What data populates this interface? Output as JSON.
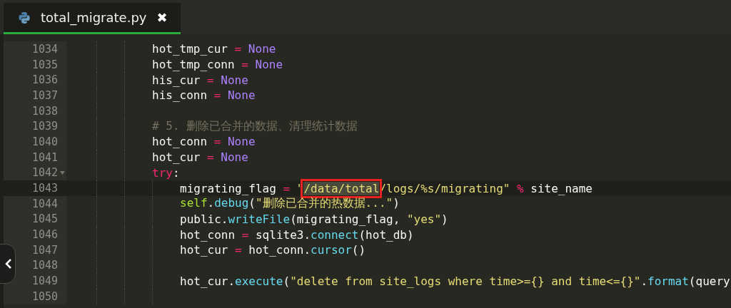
{
  "tabs": [
    {
      "label": "total_migrate.py",
      "close": "✖",
      "selected": true
    }
  ],
  "editor": {
    "lines": [
      {
        "number": "1034",
        "current": false,
        "foldable": false,
        "tokens": [
          {
            "kind": "name",
            "text": "hot_tmp_cur "
          },
          {
            "kind": "op",
            "text": "="
          },
          {
            "kind": "const",
            "text": " None"
          }
        ]
      },
      {
        "number": "1035",
        "current": false,
        "foldable": false,
        "tokens": [
          {
            "kind": "name",
            "text": "hot_tmp_conn "
          },
          {
            "kind": "op",
            "text": "="
          },
          {
            "kind": "const",
            "text": " None"
          }
        ]
      },
      {
        "number": "1036",
        "current": false,
        "foldable": false,
        "tokens": [
          {
            "kind": "name",
            "text": "his_cur "
          },
          {
            "kind": "op",
            "text": "="
          },
          {
            "kind": "const",
            "text": " None"
          }
        ]
      },
      {
        "number": "1037",
        "current": false,
        "foldable": false,
        "tokens": [
          {
            "kind": "name",
            "text": "his_conn "
          },
          {
            "kind": "op",
            "text": "="
          },
          {
            "kind": "const",
            "text": " None"
          }
        ]
      },
      {
        "number": "1038",
        "current": false,
        "foldable": false
      },
      {
        "number": "1039",
        "current": false,
        "foldable": false,
        "tokens": [
          {
            "kind": "comment",
            "text": "# 5. 删除已合并的数据、清理统计数据"
          }
        ]
      },
      {
        "number": "1040",
        "current": false,
        "foldable": false,
        "tokens": [
          {
            "kind": "name",
            "text": "hot_conn "
          },
          {
            "kind": "op",
            "text": "="
          },
          {
            "kind": "const",
            "text": " None"
          }
        ]
      },
      {
        "number": "1041",
        "current": false,
        "foldable": false,
        "tokens": [
          {
            "kind": "name",
            "text": "hot_cur "
          },
          {
            "kind": "op",
            "text": "="
          },
          {
            "kind": "const",
            "text": " None"
          }
        ]
      },
      {
        "number": "1042",
        "current": false,
        "foldable": true,
        "tokens": [
          {
            "kind": "keyword",
            "text": "try"
          },
          {
            "kind": "name",
            "text": ":"
          }
        ],
        "children": [
          {
            "number": "1043",
            "current": true,
            "foldable": false,
            "tokens": [
              {
                "kind": "name",
                "text": "migrating_flag "
              },
              {
                "kind": "op",
                "text": "="
              },
              {
                "kind": "string",
                "text": " \""
              },
              {
                "kind": "marked",
                "text": "/data/total"
              },
              {
                "kind": "string",
                "text": "/logs/%s/migrating\" "
              },
              {
                "kind": "op",
                "text": "%"
              },
              {
                "kind": "name",
                "text": " site_name"
              }
            ]
          },
          {
            "number": "1044",
            "current": false,
            "foldable": false,
            "tokens": [
              {
                "kind": "self",
                "text": "self"
              },
              {
                "kind": "name",
                "text": "."
              },
              {
                "kind": "func",
                "text": "debug"
              },
              {
                "kind": "name",
                "text": "("
              },
              {
                "kind": "string",
                "text": "\"删除已合并的热数据...\""
              },
              {
                "kind": "name",
                "text": ")"
              }
            ]
          },
          {
            "number": "1045",
            "current": false,
            "foldable": false,
            "tokens": [
              {
                "kind": "name",
                "text": "public."
              },
              {
                "kind": "func",
                "text": "writeFile"
              },
              {
                "kind": "name",
                "text": "(migrating_flag, "
              },
              {
                "kind": "string",
                "text": "\"yes\""
              },
              {
                "kind": "name",
                "text": ")"
              }
            ]
          },
          {
            "number": "1046",
            "current": false,
            "foldable": false,
            "tokens": [
              {
                "kind": "name",
                "text": "hot_conn "
              },
              {
                "kind": "op",
                "text": "="
              },
              {
                "kind": "name",
                "text": " sqlite3."
              },
              {
                "kind": "func",
                "text": "connect"
              },
              {
                "kind": "name",
                "text": "(hot_db)"
              }
            ]
          },
          {
            "number": "1047",
            "current": false,
            "foldable": false,
            "tokens": [
              {
                "kind": "name",
                "text": "hot_cur "
              },
              {
                "kind": "op",
                "text": "="
              },
              {
                "kind": "name",
                "text": " hot_conn."
              },
              {
                "kind": "func",
                "text": "cursor"
              },
              {
                "kind": "name",
                "text": "()"
              }
            ]
          },
          {
            "number": "1048",
            "current": false,
            "foldable": false
          },
          {
            "number": "1049",
            "current": false,
            "foldable": false,
            "tokens": [
              {
                "kind": "name",
                "text": "hot_cur."
              },
              {
                "kind": "func",
                "text": "execute"
              },
              {
                "kind": "name",
                "text": "("
              },
              {
                "kind": "string",
                "text": "\"delete from site_logs where time>={} and time<={}\""
              },
              {
                "kind": "name",
                "text": "."
              },
              {
                "kind": "func",
                "text": "format"
              },
              {
                "kind": "name",
                "text": "(query"
              }
            ]
          },
          {
            "number": "1050",
            "current": false,
            "foldable": false
          }
        ]
      }
    ]
  }
}
